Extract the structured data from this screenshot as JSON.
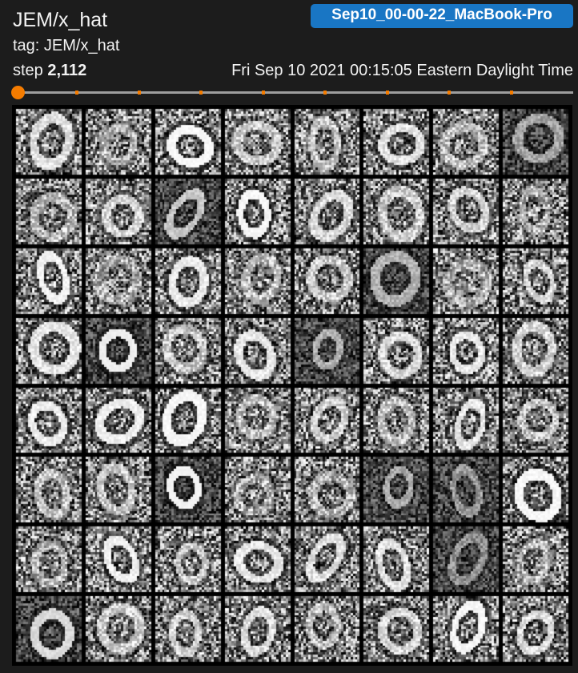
{
  "card": {
    "title": "JEM/x_hat",
    "run_name": "Sep10_00-00-22_MacBook-Pro",
    "tag_text": "tag: JEM/x_hat",
    "step_label": "step ",
    "step_value": "2,112",
    "timestamp": "Fri Sep 10 2021 00:15:05 Eastern Daylight Time"
  },
  "slider": {
    "tick_count": 8,
    "current_index": 0,
    "track_color": "#9e9e9e",
    "accent_color": "#f57c00"
  },
  "run_badge_color": "#1976c4",
  "image": {
    "grid_rows": 8,
    "grid_cols": 8,
    "content": "grayscale noisy handwritten-digit samples"
  }
}
